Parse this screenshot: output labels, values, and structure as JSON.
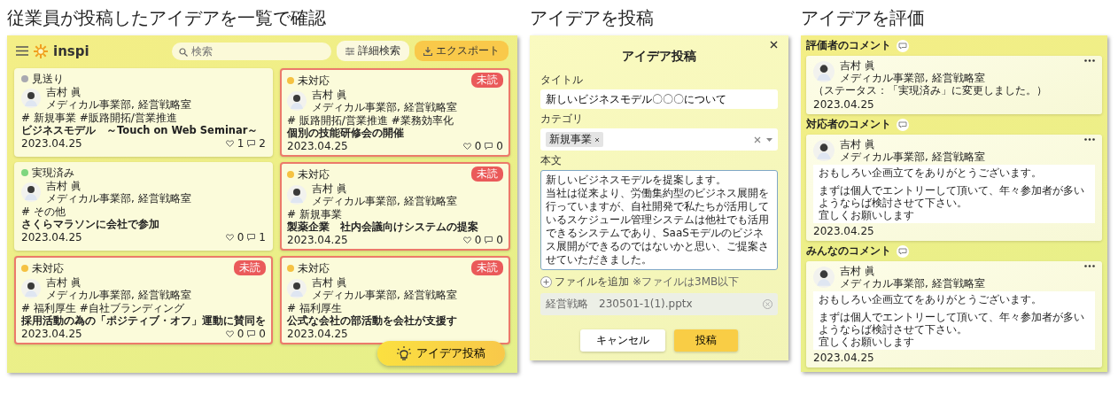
{
  "sections": [
    {
      "heading": "従業員が投稿したアイデアを一覧で確認"
    },
    {
      "heading": "アイデアを投稿"
    },
    {
      "heading": "アイデアを評価"
    }
  ],
  "list_app": {
    "logo": "inspi",
    "search": {
      "placeholder": "検索"
    },
    "detail_search": "詳細検索",
    "export": "エクスポート",
    "cards": [
      {
        "status": "見送り",
        "color": "#a9a9b0",
        "author": "吉村 眞",
        "dept": "メディカル事業部, 経営戦略室",
        "tags": "# 新規事業 #販路開拓/営業推進",
        "title": "ビジネスモデル　～Touch on Web Seminar～",
        "date": "2023.04.25",
        "likes": "1",
        "comments": "2"
      },
      {
        "status": "未対応",
        "color": "#f5c242",
        "badge": "未読",
        "author": "吉村 眞",
        "dept": "メディカル事業部, 経営戦略室",
        "tags": "# 販路開拓/営業推進 #業務効率化",
        "title": "個別の技能研修会の開催",
        "date": "2023.04.25",
        "likes": "0",
        "comments": "0"
      },
      {
        "status": "実現済み",
        "color": "#7fd67f",
        "author": "吉村 眞",
        "dept": "メディカル事業部, 経営戦略室",
        "tags": "# その他",
        "title": "さくらマラソンに会社で参加",
        "date": "2023.04.25",
        "likes": "0",
        "comments": "1"
      },
      {
        "status": "未対応",
        "color": "#f5c242",
        "badge": "未読",
        "author": "吉村 眞",
        "dept": "メディカル事業部, 経営戦略室",
        "tags": "# 新規事業",
        "title": "製薬企業　社内会議向けシステムの提案",
        "date": "2023.04.25",
        "likes": "0",
        "comments": "0"
      },
      {
        "status": "未対応",
        "color": "#f5c242",
        "badge": "未読",
        "author": "吉村 眞",
        "dept": "メディカル事業部, 経営戦略室",
        "tags": "# 福利厚生 #自社ブランディング",
        "title": "採用活動の為の「ポジティブ・オフ」運動に賛同を",
        "date": "2023.04.25",
        "likes": "0",
        "comments": "0"
      },
      {
        "status": "未対応",
        "color": "#f5c242",
        "badge": "未読",
        "author": "吉村 眞",
        "dept": "メディカル事業部, 経営戦略室",
        "tags": "# 福利厚生",
        "title": "公式な会社の部活動を会社が支援す",
        "date": "2023.04.25"
      }
    ],
    "fab": "アイデア投稿"
  },
  "post_dialog": {
    "title": "アイデア投稿",
    "title_label": "タイトル",
    "title_value": "新しいビジネスモデル〇〇〇について",
    "category_label": "カテゴリ",
    "category_chips": [
      "新規事業"
    ],
    "body_label": "本文",
    "body_paragraphs": [
      "新しいビジネスモデルを提案します。",
      "当社は従来より、労働集約型のビジネス展開を行っていますが、自社開発で私たちが活用しているスケジュール管理システムは他社でも活用できるシステムであり、SaaSモデルのビジネス展開ができるのではないかと思い、ご提案させていただきました。"
    ],
    "add_file": "ファイルを追加",
    "file_note": "※ファイルは3MB以下",
    "files": [
      "経営戦略　230501-1(1).pptx"
    ],
    "cancel": "キャンセル",
    "submit": "投稿"
  },
  "evaluation": {
    "groups": [
      {
        "heading": "評価者のコメント",
        "comments": [
          {
            "kind": "status",
            "author": "吉村 眞",
            "dept": "メディカル事業部, 経営戦略室",
            "text": "（ステータス：「実現済み」に変更しました。）",
            "date": "2023.04.25"
          }
        ]
      },
      {
        "heading": "対応者のコメント",
        "comments": [
          {
            "kind": "message",
            "author": "吉村 眞",
            "dept": "メディカル事業部, 経営戦略室",
            "paragraphs": [
              [
                "おもしろい企画立てをありがとうございます。"
              ],
              [
                "まずは個人でエントリーして頂いて、年々参加者が多いようならば検討させて下さい。",
                "宜しくお願いします"
              ]
            ],
            "date": "2023.04.25"
          }
        ]
      },
      {
        "heading": "みんなのコメント",
        "comments": [
          {
            "kind": "message",
            "author": "吉村 眞",
            "dept": "メディカル事業部, 経営戦略室",
            "paragraphs": [
              [
                "おもしろい企画立てをありがとうございます。"
              ],
              [
                "まずは個人でエントリーして頂いて、年々参加者が多いようならば検討させて下さい。",
                "宜しくお願いします"
              ]
            ],
            "date": "2023.04.25"
          }
        ]
      }
    ]
  }
}
